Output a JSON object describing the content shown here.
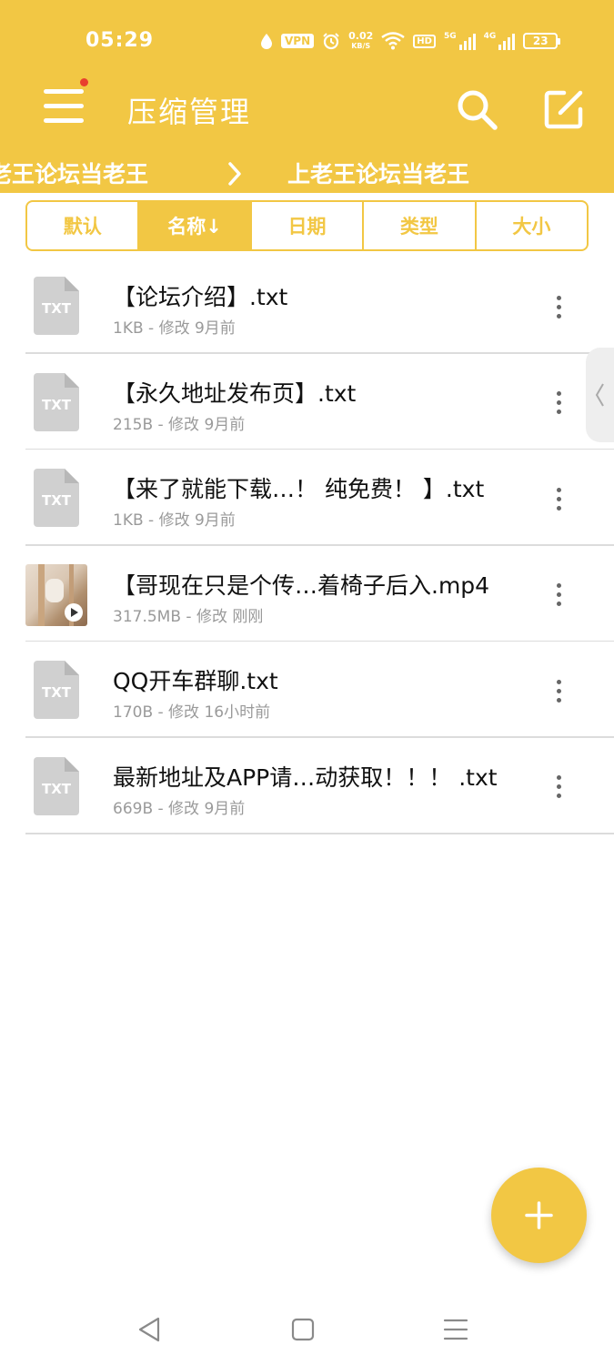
{
  "status_bar": {
    "time": "05:29",
    "vpn": "VPN",
    "net_speed": "0.02",
    "net_speed_unit": "KB/S",
    "hd_label": "HD",
    "signal_1_label": "5G",
    "signal_2_label": "4G",
    "battery": "23"
  },
  "header": {
    "title": "压缩管理",
    "menu_icon": "hamburger-menu-icon",
    "search_icon": "search-icon",
    "edit_icon": "edit-icon",
    "accent_color": "#F2C744",
    "notification_dot_color": "#E8402E"
  },
  "breadcrumb": {
    "items": [
      "老王论坛当老王",
      "上老王论坛当老王"
    ],
    "separator_icon": "chevron-right-icon"
  },
  "sort_tabs": [
    {
      "label": "默认",
      "active": false
    },
    {
      "label": "名称↓",
      "active": true
    },
    {
      "label": "日期",
      "active": false
    },
    {
      "label": "类型",
      "active": false
    },
    {
      "label": "大小",
      "active": false
    }
  ],
  "files": [
    {
      "name": "【论坛介绍】.txt",
      "meta": "1KB - 修改 9月前",
      "icon": "txt-file-icon",
      "icon_label": "TXT"
    },
    {
      "name": "【永久地址发布页】.txt",
      "meta": "215B - 修改 9月前",
      "icon": "txt-file-icon",
      "icon_label": "TXT"
    },
    {
      "name": "【来了就能下载…！ 纯免费！ 】.txt",
      "meta": "1KB - 修改 9月前",
      "icon": "txt-file-icon",
      "icon_label": "TXT"
    },
    {
      "name": "【哥现在只是个传…着椅子后入.mp4",
      "meta": "317.5MB - 修改 刚刚",
      "icon": "video-thumbnail",
      "icon_label": ""
    },
    {
      "name": "QQ开车群聊.txt",
      "meta": "170B - 修改 16小时前",
      "icon": "txt-file-icon",
      "icon_label": "TXT"
    },
    {
      "name": "最新地址及APP请…动获取！！！ .txt",
      "meta": "669B - 修改 9月前",
      "icon": "txt-file-icon",
      "icon_label": "TXT"
    }
  ],
  "fab": {
    "icon": "plus-icon"
  },
  "nav_bar": {
    "back_icon": "back-triangle-icon",
    "home_icon": "home-square-icon",
    "recents_icon": "recents-lines-icon"
  }
}
